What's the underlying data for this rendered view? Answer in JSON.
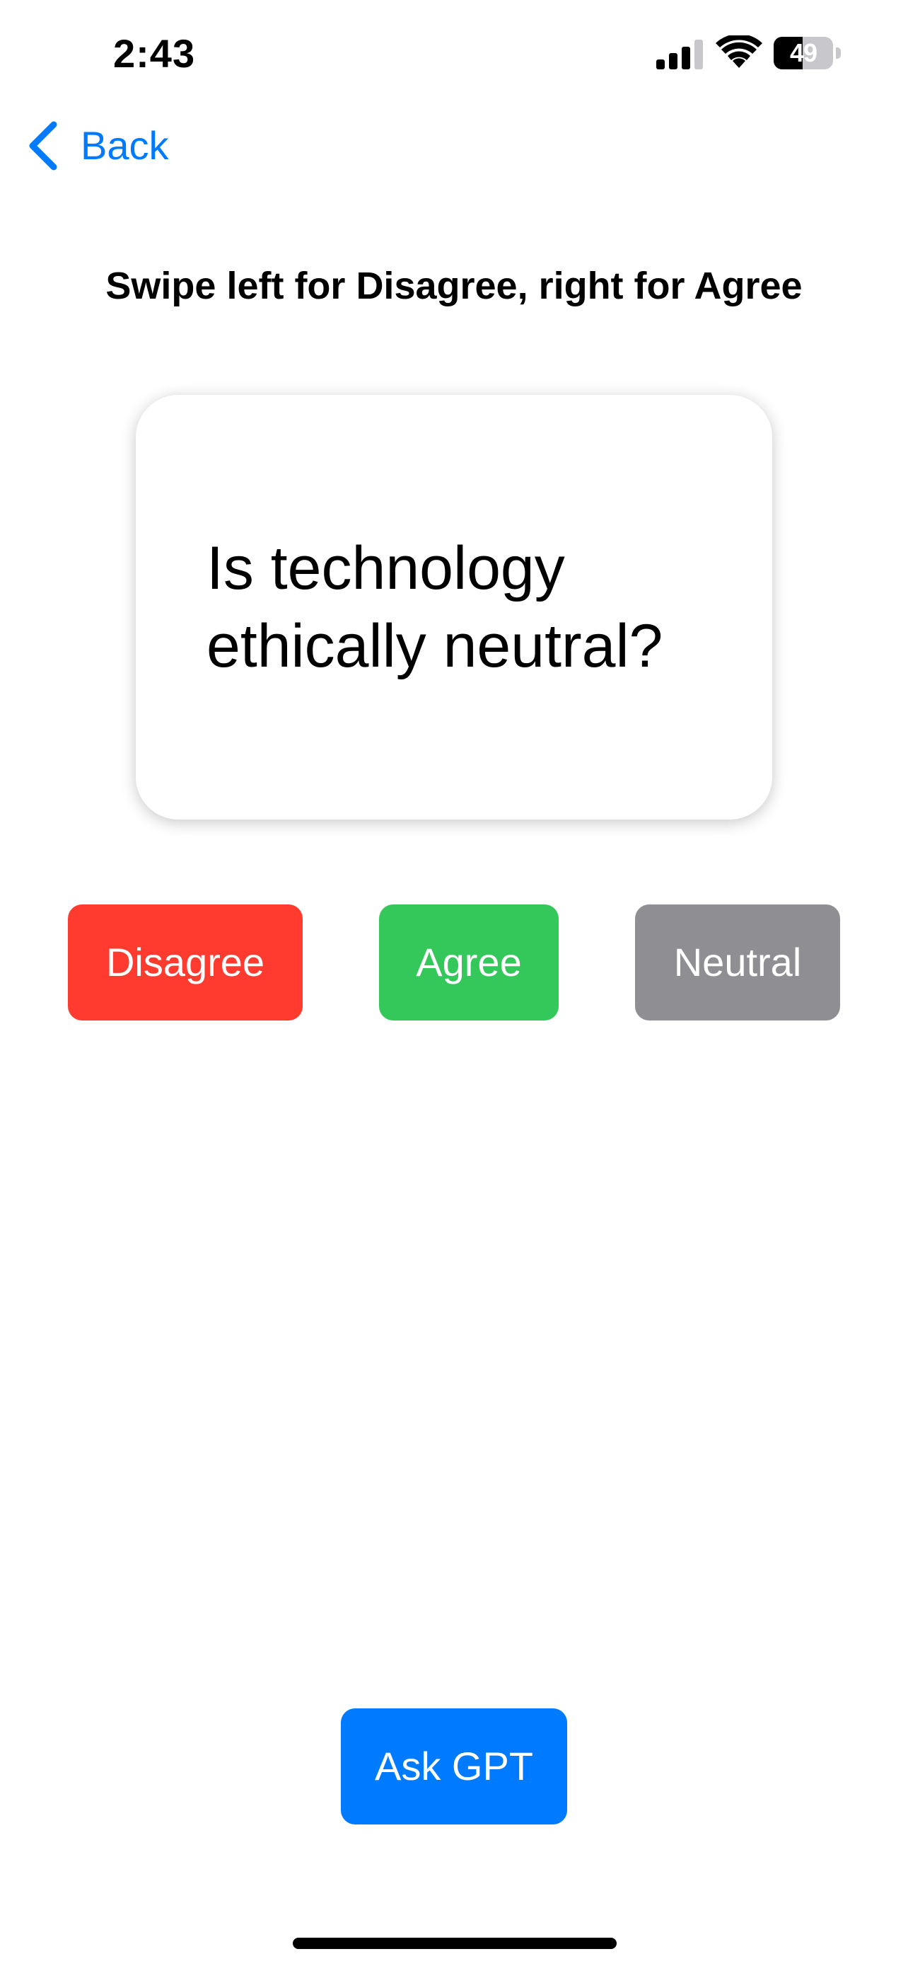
{
  "status_bar": {
    "time": "2:43",
    "battery_level": "49",
    "battery_fraction": 0.49,
    "icons": [
      "cellular-signal-icon",
      "wifi-icon",
      "battery-icon"
    ]
  },
  "nav": {
    "back_label": "Back",
    "back_icon": "chevron-left-icon"
  },
  "instruction": "Swipe left for Disagree, right for Agree",
  "card": {
    "question": "Is technology ethically neutral?"
  },
  "answers": {
    "disagree_label": "Disagree",
    "agree_label": "Agree",
    "neutral_label": "Neutral"
  },
  "ask_gpt_label": "Ask GPT",
  "colors": {
    "accent": "#007aff",
    "disagree": "#ff3b30",
    "agree": "#34c759",
    "neutral": "#8e8e93"
  }
}
